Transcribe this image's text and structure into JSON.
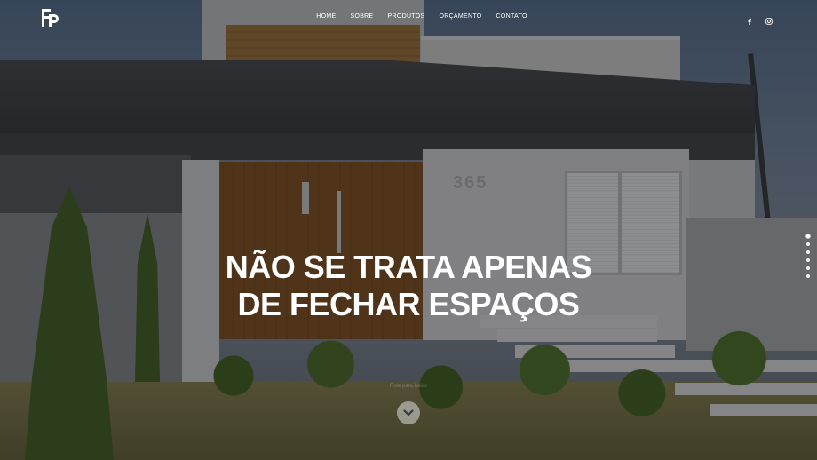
{
  "brand": {
    "logo_icon": "fp-monogram-logo"
  },
  "nav": {
    "items": [
      {
        "label": "HOME"
      },
      {
        "label": "SOBRE"
      },
      {
        "label": "PRODUTOS"
      },
      {
        "label": "ORÇAMENTO"
      },
      {
        "label": "CONTATO"
      }
    ]
  },
  "social": [
    {
      "icon": "facebook-icon"
    },
    {
      "icon": "instagram-icon"
    }
  ],
  "hero": {
    "line1": "NÃO SE TRATA APENAS",
    "line2": "DE FECHAR ESPAÇOS",
    "scroll_hint": "Role para baixo",
    "scroll_icon": "chevron-down-icon",
    "house_number": "365"
  },
  "slider": {
    "dot_count": 6,
    "active_index": 0
  },
  "colors": {
    "text": "#ffffff",
    "overlay": "rgba(0,0,0,0.42)"
  }
}
